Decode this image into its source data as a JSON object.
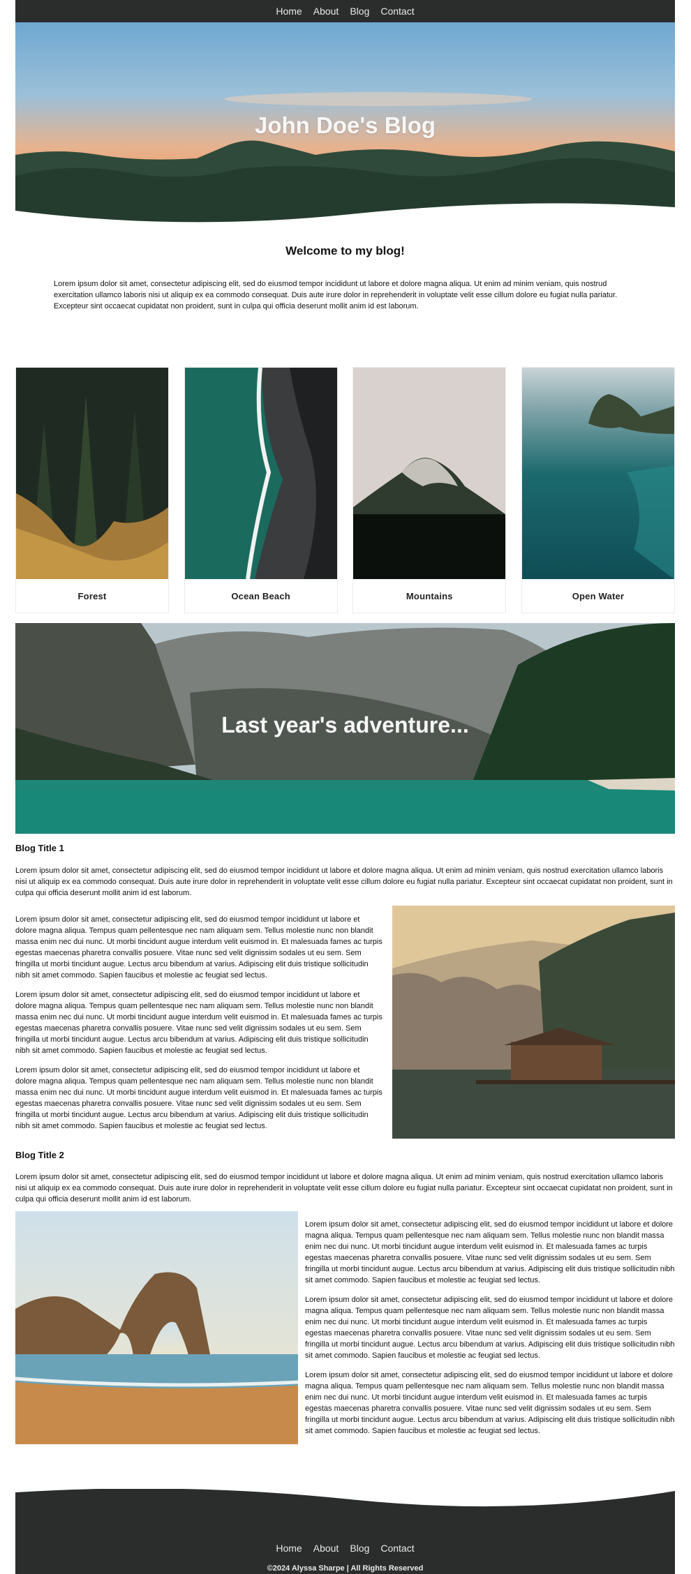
{
  "nav": {
    "items": [
      {
        "label": "Home"
      },
      {
        "label": "About"
      },
      {
        "label": "Blog"
      },
      {
        "label": "Contact"
      }
    ]
  },
  "hero": {
    "title": "John Doe's Blog"
  },
  "welcome": {
    "title": "Welcome to my blog!",
    "text": "Lorem ipsum dolor sit amet, consectetur adipiscing elit, sed do eiusmod tempor incididunt ut labore et dolore magna aliqua. Ut enim ad minim veniam, quis nostrud exercitation ullamco laboris nisi ut aliquip ex ea commodo consequat. Duis aute irure dolor in reprehenderit in voluptate velit esse cillum dolore eu fugiat nulla pariatur. Excepteur sint occaecat cupidatat non proident, sunt in culpa qui officia deserunt mollit anim id est laborum."
  },
  "cards": [
    {
      "label": "Forest"
    },
    {
      "label": "Ocean Beach"
    },
    {
      "label": "Mountains"
    },
    {
      "label": "Open Water"
    }
  ],
  "banner": {
    "title": "Last year's adventure..."
  },
  "posts": [
    {
      "title": "Blog Title 1",
      "intro": "Lorem ipsum dolor sit amet, consectetur adipiscing elit, sed do eiusmod tempor incididunt ut labore et dolore magna aliqua. Ut enim ad minim veniam, quis nostrud exercitation ullamco laboris nisi ut aliquip ex ea commodo consequat. Duis aute irure dolor in reprehenderit in voluptate velit esse cillum dolore eu fugiat nulla pariatur. Excepteur sint occaecat cupidatat non proident, sunt in culpa qui officia deserunt mollit anim id est laborum.",
      "paragraphs": [
        "Lorem ipsum dolor sit amet, consectetur adipiscing elit, sed do eiusmod tempor incididunt ut labore et dolore magna aliqua. Tempus quam pellentesque nec nam aliquam sem. Tellus molestie nunc non blandit massa enim nec dui nunc. Ut morbi tincidunt augue interdum velit euismod in. Et malesuada fames ac turpis egestas maecenas pharetra convallis posuere. Vitae nunc sed velit dignissim sodales ut eu sem. Sem fringilla ut morbi tincidunt augue. Lectus arcu bibendum at varius. Adipiscing elit duis tristique sollicitudin nibh sit amet commodo. Sapien faucibus et molestie ac feugiat sed lectus.",
        "Lorem ipsum dolor sit amet, consectetur adipiscing elit, sed do eiusmod tempor incididunt ut labore et dolore magna aliqua. Tempus quam pellentesque nec nam aliquam sem. Tellus molestie nunc non blandit massa enim nec dui nunc. Ut morbi tincidunt augue interdum velit euismod in. Et malesuada fames ac turpis egestas maecenas pharetra convallis posuere. Vitae nunc sed velit dignissim sodales ut eu sem. Sem fringilla ut morbi tincidunt augue. Lectus arcu bibendum at varius. Adipiscing elit duis tristique sollicitudin nibh sit amet commodo. Sapien faucibus et molestie ac feugiat sed lectus.",
        "Lorem ipsum dolor sit amet, consectetur adipiscing elit, sed do eiusmod tempor incididunt ut labore et dolore magna aliqua. Tempus quam pellentesque nec nam aliquam sem. Tellus molestie nunc non blandit massa enim nec dui nunc. Ut morbi tincidunt augue interdum velit euismod in. Et malesuada fames ac turpis egestas maecenas pharetra convallis posuere. Vitae nunc sed velit dignissim sodales ut eu sem. Sem fringilla ut morbi tincidunt augue. Lectus arcu bibendum at varius. Adipiscing elit duis tristique sollicitudin nibh sit amet commodo. Sapien faucibus et molestie ac feugiat sed lectus."
      ]
    },
    {
      "title": "Blog Title 2",
      "intro": "Lorem ipsum dolor sit amet, consectetur adipiscing elit, sed do eiusmod tempor incididunt ut labore et dolore magna aliqua. Ut enim ad minim veniam, quis nostrud exercitation ullamco laboris nisi ut aliquip ex ea commodo consequat. Duis aute irure dolor in reprehenderit in voluptate velit esse cillum dolore eu fugiat nulla pariatur. Excepteur sint occaecat cupidatat non proident, sunt in culpa qui officia deserunt mollit anim id est laborum.",
      "paragraphs": [
        "Lorem ipsum dolor sit amet, consectetur adipiscing elit, sed do eiusmod tempor incididunt ut labore et dolore magna aliqua. Tempus quam pellentesque nec nam aliquam sem. Tellus molestie nunc non blandit massa enim nec dui nunc. Ut morbi tincidunt augue interdum velit euismod in. Et malesuada fames ac turpis egestas maecenas pharetra convallis posuere. Vitae nunc sed velit dignissim sodales ut eu sem. Sem fringilla ut morbi tincidunt augue. Lectus arcu bibendum at varius. Adipiscing elit duis tristique sollicitudin nibh sit amet commodo. Sapien faucibus et molestie ac feugiat sed lectus.",
        "Lorem ipsum dolor sit amet, consectetur adipiscing elit, sed do eiusmod tempor incididunt ut labore et dolore magna aliqua. Tempus quam pellentesque nec nam aliquam sem. Tellus molestie nunc non blandit massa enim nec dui nunc. Ut morbi tincidunt augue interdum velit euismod in. Et malesuada fames ac turpis egestas maecenas pharetra convallis posuere. Vitae nunc sed velit dignissim sodales ut eu sem. Sem fringilla ut morbi tincidunt augue. Lectus arcu bibendum at varius. Adipiscing elit duis tristique sollicitudin nibh sit amet commodo. Sapien faucibus et molestie ac feugiat sed lectus.",
        "Lorem ipsum dolor sit amet, consectetur adipiscing elit, sed do eiusmod tempor incididunt ut labore et dolore magna aliqua. Tempus quam pellentesque nec nam aliquam sem. Tellus molestie nunc non blandit massa enim nec dui nunc. Ut morbi tincidunt augue interdum velit euismod in. Et malesuada fames ac turpis egestas maecenas pharetra convallis posuere. Vitae nunc sed velit dignissim sodales ut eu sem. Sem fringilla ut morbi tincidunt augue. Lectus arcu bibendum at varius. Adipiscing elit duis tristique sollicitudin nibh sit amet commodo. Sapien faucibus et molestie ac feugiat sed lectus."
      ]
    }
  ],
  "footer": {
    "nav": [
      {
        "label": "Home"
      },
      {
        "label": "About"
      },
      {
        "label": "Blog"
      },
      {
        "label": "Contact"
      }
    ],
    "copyright": "©2024 Alyssa Sharpe | All Rights Reserved"
  },
  "colors": {
    "nav_bg": "#2b2c2c",
    "footer_bg": "#2b2c2c",
    "nav_text": "#e9e9e9",
    "hero_title": "#f7f7f7"
  }
}
